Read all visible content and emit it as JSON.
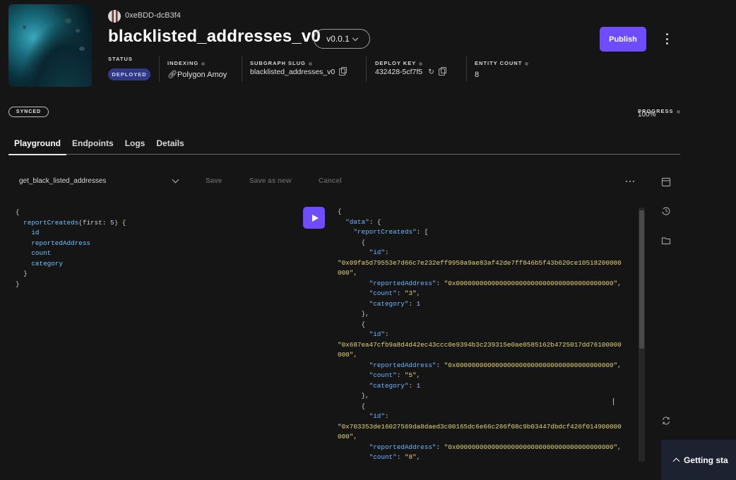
{
  "header": {
    "owner": "0xeBDD-dcB3f4",
    "title": "blacklisted_addresses_v0",
    "version": "v0.0.1",
    "publish_label": "Publish"
  },
  "meta": {
    "status": {
      "label": "STATUS",
      "value": "DEPLOYED"
    },
    "indexing": {
      "label": "INDEXING",
      "value": "Polygon Amoy"
    },
    "slug": {
      "label": "SUBGRAPH SLUG",
      "value": "blacklisted_addresses_v0"
    },
    "deploy_key": {
      "label": "DEPLOY KEY",
      "value": "432428-5cf7f5"
    },
    "entity_count": {
      "label": "ENTITY COUNT",
      "value": "8"
    }
  },
  "sync": {
    "badge": "SYNCED",
    "progress_label": "PROGRESS",
    "progress_value": "100%"
  },
  "tabs": [
    {
      "label": "Playground",
      "active": true
    },
    {
      "label": "Endpoints",
      "active": false
    },
    {
      "label": "Logs",
      "active": false
    },
    {
      "label": "Details",
      "active": false
    }
  ],
  "toolbar": {
    "query_name": "get_black_listed_addresses",
    "save_label": "Save",
    "save_as_new_label": "Save as new",
    "cancel_label": "Cancel"
  },
  "query": {
    "field": "reportCreateds",
    "arg_name": "first",
    "arg_value": "5",
    "subfields": [
      "id",
      "reportedAddress",
      "count",
      "category"
    ]
  },
  "result": {
    "data_key": "data",
    "collection_key": "reportCreateds",
    "items": [
      {
        "id_line1": "\"0x09fa5d79553e7d66c7e232eff9958a9ae83af42de7ff846b5f43b620ce10518200000",
        "id_line2": "000\",",
        "reportedAddress": "\"0x0000000000000000000000000000000000000000\",",
        "count": "\"3\",",
        "category": "1"
      },
      {
        "id_line1": "\"0x687ea47cfb9a8d4d42ec43ccc0e9394b3c239315e0ae0585162b4725017dd76100000",
        "id_line2": "000\",",
        "reportedAddress": "\"0x0000000000000000000000000000000000000000\",",
        "count": "\"5\",",
        "category": "1"
      },
      {
        "id_line1": "\"0x703353de16027569da8daed3c00165dc6e66c286f08c9b03447dbdcf426f014900000",
        "id_line2": "000\",",
        "reportedAddress": "\"0x0000000000000000000000000000000000000000\",",
        "count": "\"8\","
      }
    ]
  },
  "getting_started": "Getting sta",
  "colors": {
    "accent": "#6f4cff",
    "deployed_badge": "#2e3a86",
    "background": "#151515"
  }
}
